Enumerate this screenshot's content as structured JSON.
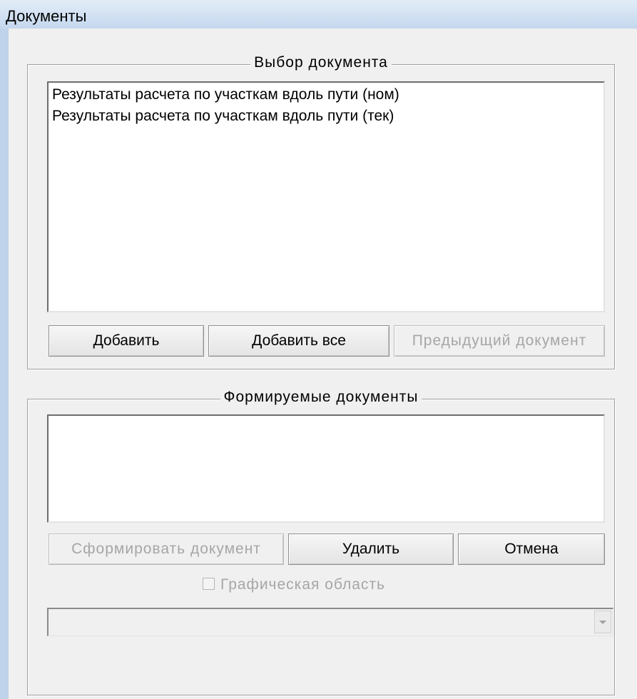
{
  "window": {
    "title": "Документы"
  },
  "select_group": {
    "title": "Выбор  документа",
    "items": [
      "Результаты расчета по участкам вдоль пути (ном)",
      "Результаты расчета по участкам вдоль пути (тек)"
    ],
    "buttons": {
      "add": "Добавить",
      "add_all": "Добавить все",
      "previous": "Предыдущий  документ"
    }
  },
  "output_group": {
    "title": "Формируемые  документы",
    "items": [],
    "buttons": {
      "generate": "Сформировать  документ",
      "delete": "Удалить",
      "cancel": "Отмена"
    },
    "graphic_area_checkbox": {
      "label": "Графическая  область",
      "checked": false,
      "enabled": false
    },
    "combo_value": ""
  },
  "colors": {
    "dialog_background": "#f0f0f0",
    "disabled_text": "#a6a6a6",
    "title_bar": "#d0e0f2"
  }
}
